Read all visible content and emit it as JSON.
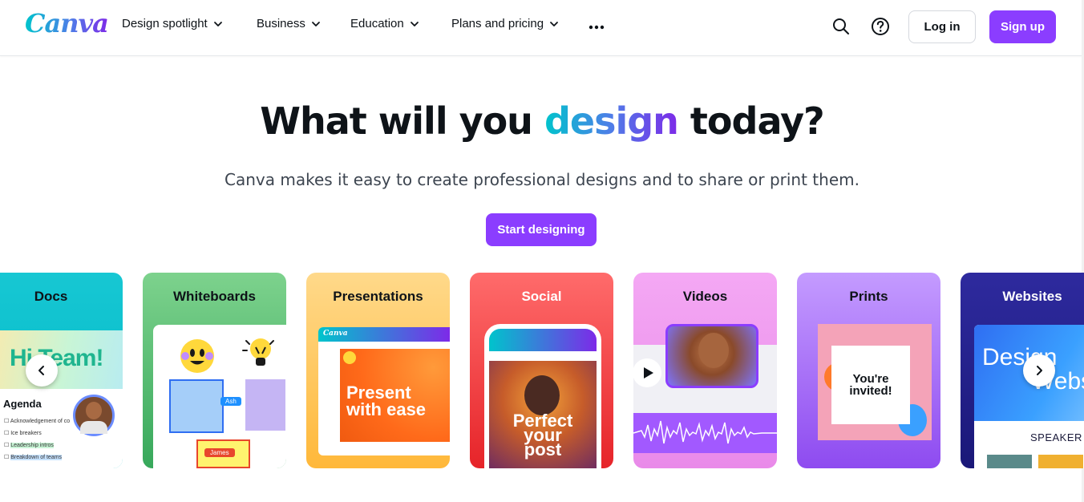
{
  "header": {
    "logo": "Canva",
    "nav": [
      "Design spotlight",
      "Business",
      "Education",
      "Plans and pricing"
    ],
    "login": "Log in",
    "signup": "Sign up"
  },
  "hero": {
    "title_pre": "What will you ",
    "title_accent": "design",
    "title_post": " today?",
    "subtitle": "Canva makes it easy to create professional designs and to share or print them.",
    "cta": "Start designing"
  },
  "cards": [
    {
      "label": "Docs",
      "preview": {
        "headline": "Hi Team!",
        "section": "Agenda",
        "items": [
          "Acknowledgement of co",
          "Ice breakers",
          "Leadership intros",
          "Breakdown of teams"
        ]
      }
    },
    {
      "label": "Whiteboards",
      "preview": {
        "tag1": "Ash",
        "tag2": "James"
      }
    },
    {
      "label": "Presentations",
      "preview": {
        "brand": "Canva",
        "headline1": "Present",
        "headline2": "with ease"
      }
    },
    {
      "label": "Social",
      "preview": {
        "line1": "Perfect",
        "line2": "your",
        "line3": "post"
      }
    },
    {
      "label": "Videos"
    },
    {
      "label": "Prints",
      "preview": {
        "line1": "You're",
        "line2": "invited!"
      }
    },
    {
      "label": "Websites",
      "preview": {
        "line1": "Design",
        "line2": "Websi",
        "speaker": "SPEAKER"
      }
    }
  ],
  "colors": {
    "brand_purple": "#8b3dff",
    "text_dark": "#0e1318",
    "gradient_start": "#00c4cc",
    "gradient_end": "#7d2ae8"
  },
  "icons": [
    "chevron-down-icon",
    "more-icon",
    "search-icon",
    "help-icon",
    "arrow-left-icon",
    "arrow-right-icon",
    "play-icon"
  ]
}
